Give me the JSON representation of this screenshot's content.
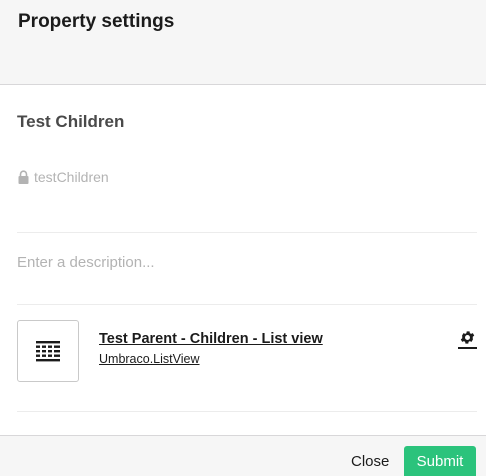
{
  "header": {
    "title": "Property settings"
  },
  "property": {
    "name": "Test Children",
    "alias": "testChildren",
    "description_placeholder": "Enter a description..."
  },
  "editor": {
    "name": "Test Parent - Children - List view",
    "alias": "Umbraco.ListView",
    "icon": "list-view-icon"
  },
  "footer": {
    "close_label": "Close",
    "submit_label": "Submit"
  },
  "colors": {
    "submit_bg": "#2bc37c",
    "header_bg": "#f6f6f6"
  }
}
